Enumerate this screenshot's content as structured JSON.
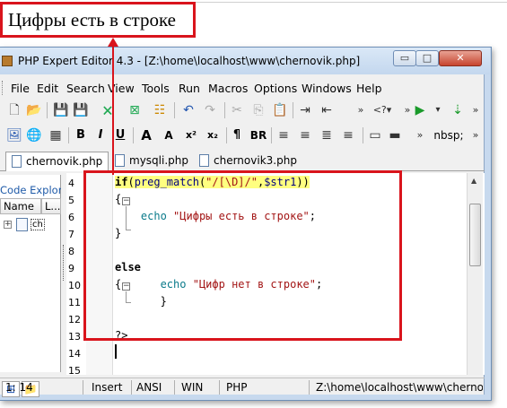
{
  "callout": {
    "text": "Цифры есть в строке"
  },
  "window": {
    "title": "PHP Expert Editor 4.3 - [Z:\\home\\localhost\\www\\chernovik.php]",
    "min_glyph": "▭",
    "max_glyph": "□",
    "close_glyph": "✕"
  },
  "menu": [
    "File",
    "Edit",
    "Search",
    "View",
    "Tools",
    "Run",
    "Macros",
    "Options",
    "Windows",
    "Help"
  ],
  "toolbar2_text": {
    "bold": "B",
    "italic": "I",
    "underline": "U",
    "font_up": "A",
    "font_down": "A",
    "sup": "x²",
    "sub": "x₂",
    "pilcrow": "¶",
    "br": "BR",
    "nbsp": "nbsp;"
  },
  "tabs": [
    "chernovik.php",
    "mysqli.php",
    "chernovik3.php"
  ],
  "explorer": {
    "title": "Code Explorer",
    "col_name": "Name",
    "col_l": "L...",
    "item": "ch"
  },
  "editor": {
    "lines": [
      {
        "no": "4",
        "code": "if(preg_match(\"/[\\D]/\",$str1))"
      },
      {
        "no": "5",
        "code": "{"
      },
      {
        "no": "6",
        "code": "    echo \"Цифры есть в строке\";"
      },
      {
        "no": "7",
        "code": "}"
      },
      {
        "no": "8",
        "code": ""
      },
      {
        "no": "9",
        "code": "else"
      },
      {
        "no": "10",
        "code": "{      echo \"Цифр нет в строке\";"
      },
      {
        "no": "11",
        "code": "       }"
      },
      {
        "no": "12",
        "code": ""
      },
      {
        "no": "13",
        "code": "?>"
      },
      {
        "no": "14",
        "code": ""
      },
      {
        "no": "15",
        "code": ""
      }
    ]
  },
  "status": {
    "position": "1: 14",
    "mode": "Insert",
    "encoding": "ANSI",
    "lineend": "WIN",
    "lang": "PHP",
    "path": "Z:\\home\\localhost\\www\\cherno"
  },
  "colors": {
    "annotation_red": "#d9141c",
    "highlight_yellow": "#ffff80",
    "echo_teal": "#0a7a8a",
    "string_red": "#a31515"
  }
}
